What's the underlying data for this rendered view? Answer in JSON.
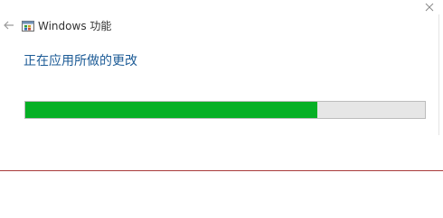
{
  "window": {
    "title": "Windows 功能",
    "icons": {
      "back": "back-arrow-icon",
      "app": "windows-features-icon",
      "close": "close-icon"
    }
  },
  "main": {
    "heading": "正在应用所做的更改",
    "progress": {
      "percent": 73,
      "fill_color": "#06b025",
      "track_color": "#e6e6e6"
    }
  },
  "colors": {
    "heading": "#1c5b96",
    "footer_divider": "#a83a3a"
  }
}
